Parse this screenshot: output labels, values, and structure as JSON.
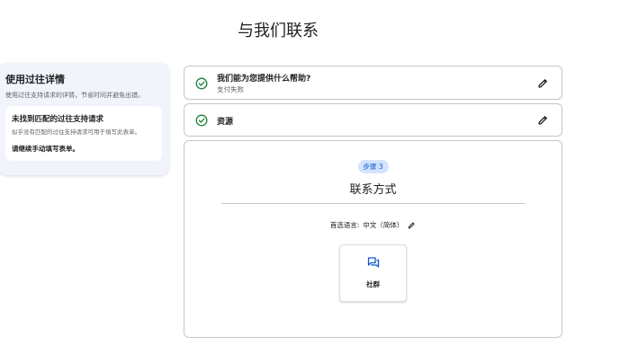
{
  "page": {
    "title": "与我们联系"
  },
  "past_details": {
    "title": "使用过往详情",
    "description": "使用过往支持请求的详情，节省时间并避免出错。",
    "notice": {
      "title": "未找到匹配的过往支持请求",
      "description": "似乎没有匹配的过往支持请求可用于填写此表单。",
      "note": "请继续手动填写表单。"
    }
  },
  "steps": [
    {
      "question": "我们能为您提供什么帮助?",
      "answer": "支付失败",
      "status": "complete"
    },
    {
      "label": "资源",
      "status": "complete"
    }
  ],
  "step3": {
    "badge": "步骤 3",
    "heading": "联系方式",
    "language_label": "首选语言:",
    "language_value": "中文（简体）",
    "options": [
      {
        "label": "社群",
        "icon": "forum-chat-icon"
      }
    ]
  },
  "colors": {
    "check": "#188038",
    "accent": "#0b57d0",
    "badge_bg": "#d3e3fd"
  }
}
